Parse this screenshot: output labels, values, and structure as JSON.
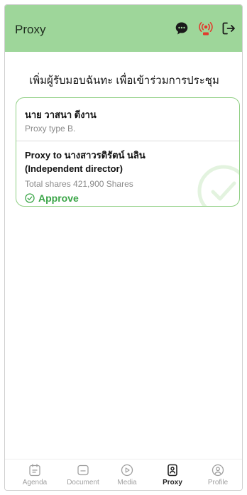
{
  "header": {
    "title": "Proxy"
  },
  "heading": "เพิ่มผู้รับมอบฉันทะ เพื่อเข้าร่วมการประชุม",
  "proxy_card": {
    "grantor_name": "นาย วาสนา ดีงาน",
    "proxy_type": "Proxy type B.",
    "proxy_to": "Proxy to นางสาวรติรัตน์ นลิน",
    "proxy_role": "(Independent director)",
    "total_shares": "Total shares 421,900 Shares",
    "status": "Approve"
  },
  "icons": {
    "top": [
      "chat-icon",
      "live-broadcast-icon",
      "logout-icon"
    ],
    "status": "check-circle-icon"
  },
  "colors": {
    "header_bg": "#9ed69a",
    "accent": "#3aa547",
    "card_border": "#8fcf83",
    "live_red": "#e23b2e"
  },
  "bottom_nav": {
    "items": [
      {
        "label": "Agenda",
        "icon": "agenda-icon"
      },
      {
        "label": "Document",
        "icon": "document-icon"
      },
      {
        "label": "Media",
        "icon": "media-play-icon"
      },
      {
        "label": "Proxy",
        "icon": "proxy-icon",
        "active": true
      },
      {
        "label": "Profile",
        "icon": "profile-icon"
      }
    ]
  }
}
